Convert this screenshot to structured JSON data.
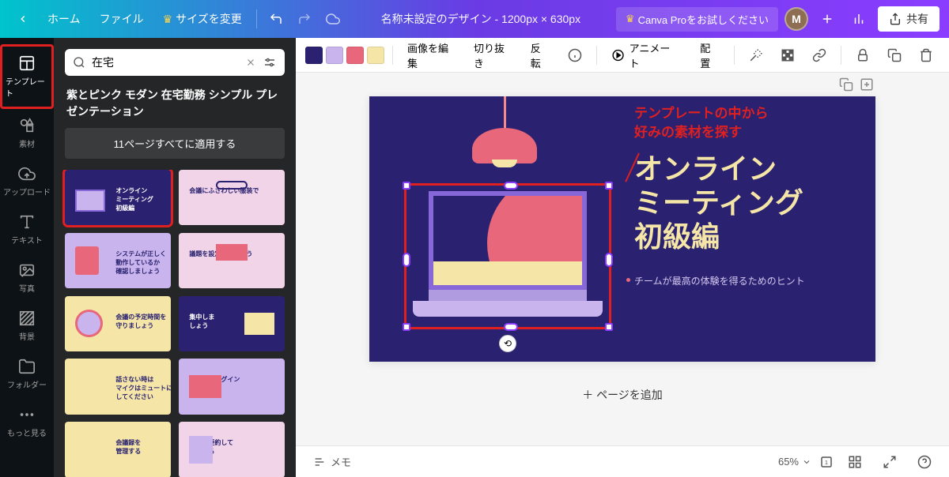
{
  "top": {
    "home": "ホーム",
    "file": "ファイル",
    "resize": "サイズを変更",
    "doc_title": "名称未設定のデザイン",
    "doc_dims": "1200px × 630px",
    "pro": "Canva Proをお試しください",
    "avatar_letter": "M",
    "share": "共有"
  },
  "rail": {
    "templates": "テンプレート",
    "elements": "素材",
    "uploads": "アップロード",
    "text": "テキスト",
    "photos": "写真",
    "background": "背景",
    "folders": "フォルダー",
    "more": "もっと見る"
  },
  "panel": {
    "search_value": "在宅",
    "template_name": "紫とピンク モダン 在宅勤務 シンプル プレゼンテーション",
    "apply_all": "11ページすべてに適用する",
    "thumbs": [
      {
        "title": "オンライン\nミーティング\n初級編",
        "bg": "#2a2270",
        "accent": "laptop"
      },
      {
        "title": "会議にふさわしい服装で",
        "bg": "#f1d4e8",
        "accent": "glasses"
      },
      {
        "title": "システムが正しく\n動作しているか\n確認しましょう",
        "bg": "#c9b4ed",
        "accent": "tablet"
      },
      {
        "title": "議題を設定しましょう",
        "bg": "#f1d4e8",
        "accent": "book"
      },
      {
        "title": "会議の予定時間を\n守りましょう",
        "bg": "#f5e6a8",
        "accent": "clock"
      },
      {
        "title": "集中しま\nしょう",
        "bg": "#2a2270",
        "accent": "monitor"
      },
      {
        "title": "話さない時は\nマイクはミュートに\nしてください",
        "bg": "#f5e6a8",
        "accent": "text"
      },
      {
        "title": "会議へのログイン\nを知らせる",
        "bg": "#c9b4ed",
        "accent": "desk"
      },
      {
        "title": "会議録を\n管理する",
        "bg": "#f5e6a8",
        "accent": "text"
      },
      {
        "title": "会議を要約して\n完了する",
        "bg": "#f1d4e8",
        "accent": "notepad"
      }
    ]
  },
  "toolbar": {
    "swatches": [
      "#2a2270",
      "#c9b4ed",
      "#e8677a",
      "#f5e6a8"
    ],
    "edit_image": "画像を編集",
    "crop": "切り抜き",
    "flip": "反転",
    "animate": "アニメート",
    "position": "配置"
  },
  "canvas": {
    "annotation_l1": "テンプレートの中から",
    "annotation_l2": "好みの素材を探す",
    "title_l1": "オンライン",
    "title_l2": "ミーティング",
    "title_l3": "初級編",
    "subtitle": "チームが最高の体験を得るためのヒント",
    "add_page": "＋ ページを追加"
  },
  "bottom": {
    "notes": "メモ",
    "zoom": "65%",
    "page": "1"
  }
}
